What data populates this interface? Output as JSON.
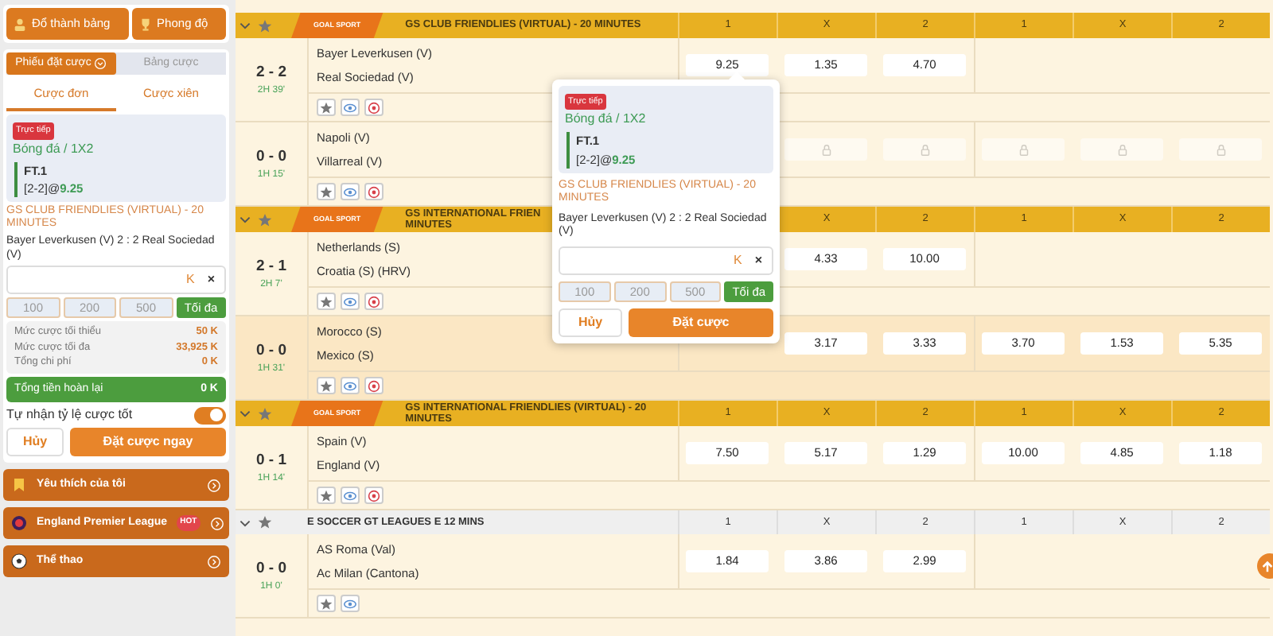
{
  "sidebar": {
    "top_buttons": [
      {
        "label": "Đổ thành bảng"
      },
      {
        "label": "Phong độ"
      }
    ],
    "slip_tabs": [
      {
        "label": "Phiếu đặt cược",
        "selected": true
      },
      {
        "label": "Bảng cược",
        "selected": false
      }
    ],
    "bet_types": [
      {
        "label": "Cược đơn",
        "selected": true
      },
      {
        "label": "Cược xiên",
        "selected": false
      }
    ],
    "ticket": {
      "badge": "Trực tiếp",
      "market": "Bóng đá / 1X2",
      "pick": "FT.1",
      "score": "[2-2]",
      "at": "@",
      "price": "9.25",
      "league": "GS CLUB FRIENDLIES (VIRTUAL) - 20 MINUTES",
      "fixture": "Bayer Leverkusen (V) 2 : 2  Real Sociedad (V)",
      "unit": "K",
      "clear": "×"
    },
    "chips": [
      "100",
      "200",
      "500"
    ],
    "max": "Tối đa",
    "limits": [
      {
        "label": "Mức cược tối thiểu",
        "value": "50 K"
      },
      {
        "label": "Mức cược tối đa",
        "value": "33,925 K"
      },
      {
        "label": "Tổng chi phí",
        "value": "0 K"
      }
    ],
    "refund": {
      "label": "Tổng tiền hoàn lại",
      "value": "0 K"
    },
    "auto_odds": {
      "label": "Tự nhận tỷ lệ cược tốt",
      "on": true
    },
    "cancel": "Hủy",
    "submit": "Đặt cược ngay",
    "menu": [
      {
        "label": "Yêu thích của tôi"
      },
      {
        "label": "England Premier League",
        "badge": "HOT"
      },
      {
        "label": "Thể thao"
      }
    ]
  },
  "groups": [
    {
      "kind": "logo",
      "logo_text": "GOAL SPORT",
      "title_lines": [
        "GS CLUB FRIENDLIES (VIRTUAL) - 20 MINUTES"
      ],
      "columns": [
        "1",
        "X",
        "2",
        "1",
        "X",
        "2"
      ],
      "matches": [
        {
          "score": "2 - 2",
          "time": "2H 39'",
          "home": "Bayer Leverkusen (V)",
          "away": "Real Sociedad (V)",
          "highlighted": false,
          "stats_button": true,
          "odds_ft": [
            "9.25",
            "1.35",
            "4.70"
          ]
        },
        {
          "score": "0 - 0",
          "time": "1H 15'",
          "home": "Napoli (V)",
          "away": "Villarreal (V)",
          "highlighted": false,
          "stats_button": true,
          "odds_ft": [
            {
              "locked": true
            },
            {
              "locked": true
            }
          ],
          "odds_h1": [
            {
              "locked": true
            },
            {
              "locked": true
            },
            {
              "locked": true
            }
          ]
        }
      ]
    },
    {
      "kind": "logo",
      "logo_text": "GOAL SPORT",
      "title_lines": [
        "GS INTERNATIONAL FRIEN",
        "MINUTES"
      ],
      "columns": [
        "X",
        "2",
        "1",
        "X",
        "2"
      ],
      "matches": [
        {
          "score": "2 - 1",
          "time": "2H 7'",
          "home": "Netherlands (S)",
          "away": "Croatia (S) (HRV)",
          "highlighted": false,
          "stats_button": true,
          "odds_ft": [
            "4.33",
            "10.00"
          ]
        },
        {
          "score": "0 - 0",
          "time": "1H 31'",
          "home": "Morocco (S)",
          "away": "Mexico (S)",
          "highlighted": true,
          "stats_button": true,
          "odds_ft": [
            "3.17",
            "3.33"
          ],
          "odds_h1": [
            "3.70",
            "1.53",
            "5.35"
          ]
        }
      ]
    },
    {
      "kind": "logo",
      "logo_text": "GOAL SPORT",
      "title_lines": [
        "GS INTERNATIONAL FRIENDLIES (VIRTUAL) - 20",
        "MINUTES"
      ],
      "columns": [
        "1",
        "X",
        "2",
        "1",
        "X",
        "2"
      ],
      "matches": [
        {
          "score": "0 - 1",
          "time": "1H 14'",
          "home": "Spain (V)",
          "away": "England (V)",
          "highlighted": false,
          "stats_button": true,
          "odds_ft": [
            "7.50",
            "5.17",
            "1.29"
          ],
          "odds_h1": [
            "10.00",
            "4.85",
            "1.18"
          ]
        }
      ]
    },
    {
      "kind": "plain",
      "title_lines": [
        "E SOCCER GT LEAGUES E 12 MINS"
      ],
      "columns": [
        "1",
        "X",
        "2",
        "1",
        "X",
        "2"
      ],
      "matches": [
        {
          "score": "0 - 0",
          "time": "1H 0'",
          "home": "AS Roma (Val)",
          "away": "Ac Milan (Cantona)",
          "highlighted": false,
          "stats_button": false,
          "odds_ft": [
            "1.84",
            "3.86",
            "2.99"
          ]
        }
      ]
    }
  ],
  "popup": {
    "ticket": {
      "badge": "Trực tiếp",
      "market": "Bóng đá / 1X2",
      "pick": "FT.1",
      "score": "[2-2]",
      "at": "@",
      "price": "9.25",
      "league": "GS CLUB FRIENDLIES (VIRTUAL) - 20 MINUTES",
      "fixture": "Bayer Leverkusen (V) 2 : 2  Real Sociedad (V)",
      "unit": "K",
      "clear": "×"
    },
    "chips": [
      "100",
      "200",
      "500"
    ],
    "max": "Tối đa",
    "cancel": "Hủy",
    "submit": "Đặt cược"
  }
}
